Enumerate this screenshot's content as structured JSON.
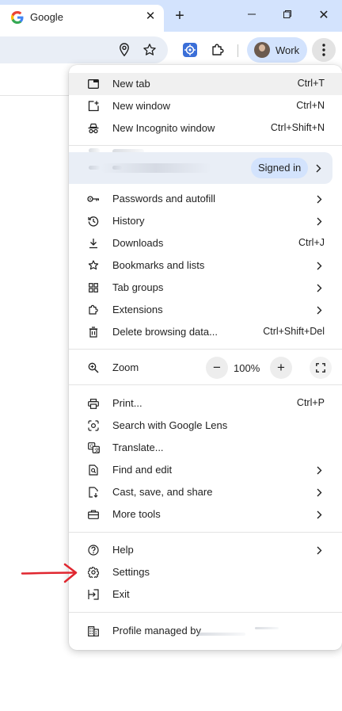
{
  "tab": {
    "title": "Google"
  },
  "window": {
    "new_tab_symbol": "+",
    "minimize_symbol": "—",
    "close_symbol": "✕"
  },
  "toolbar": {
    "profile_label": "Work"
  },
  "menu": {
    "top_items": [
      {
        "label": "New tab",
        "shortcut": "Ctrl+T",
        "icon": "new-tab-icon"
      },
      {
        "label": "New window",
        "shortcut": "Ctrl+N",
        "icon": "new-window-icon"
      },
      {
        "label": "New Incognito window",
        "shortcut": "Ctrl+Shift+N",
        "icon": "incognito-icon"
      }
    ],
    "account": {
      "status": "Signed in"
    },
    "browser_items": [
      {
        "label": "Passwords and autofill",
        "icon": "key-icon",
        "submenu": true
      },
      {
        "label": "History",
        "icon": "history-icon",
        "submenu": true
      },
      {
        "label": "Downloads",
        "shortcut": "Ctrl+J",
        "icon": "download-icon"
      },
      {
        "label": "Bookmarks and lists",
        "icon": "star-icon",
        "submenu": true
      },
      {
        "label": "Tab groups",
        "icon": "tab-groups-icon",
        "submenu": true
      },
      {
        "label": "Extensions",
        "icon": "puzzle-icon",
        "submenu": true
      },
      {
        "label": "Delete browsing data...",
        "shortcut": "Ctrl+Shift+Del",
        "icon": "trash-icon"
      }
    ],
    "zoom": {
      "label": "Zoom",
      "value": "100%",
      "minus": "−",
      "plus": "+"
    },
    "tool_items": [
      {
        "label": "Print...",
        "shortcut": "Ctrl+P",
        "icon": "print-icon"
      },
      {
        "label": "Search with Google Lens",
        "icon": "lens-icon"
      },
      {
        "label": "Translate...",
        "icon": "translate-icon"
      },
      {
        "label": "Find and edit",
        "icon": "find-icon",
        "submenu": true
      },
      {
        "label": "Cast, save, and share",
        "icon": "cast-icon",
        "submenu": true
      },
      {
        "label": "More tools",
        "icon": "toolbox-icon",
        "submenu": true
      }
    ],
    "help_items": [
      {
        "label": "Help",
        "icon": "help-icon",
        "submenu": true
      },
      {
        "label": "Settings",
        "icon": "gear-icon"
      },
      {
        "label": "Exit",
        "icon": "exit-icon"
      }
    ],
    "managed": {
      "label": "Profile managed by"
    }
  },
  "colors": {
    "tabstrip": "#d3e3fd",
    "omnibox": "#e9eef6",
    "hover": "#f0f0f0",
    "annotation_arrow": "#e0262f"
  }
}
